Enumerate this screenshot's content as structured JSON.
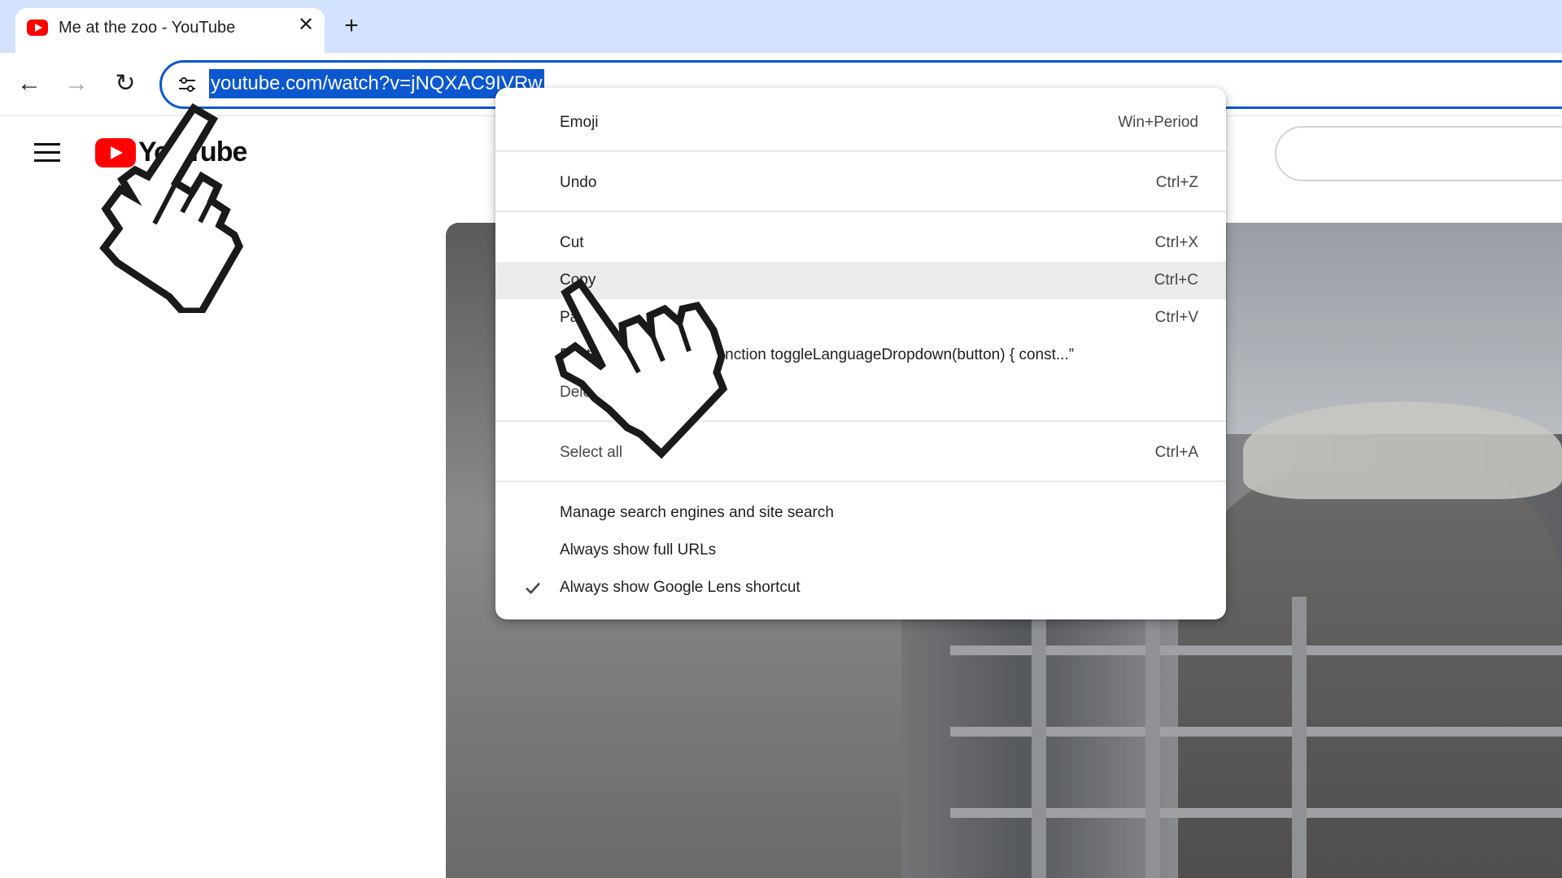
{
  "tab": {
    "title": "Me at the zoo - YouTube",
    "close_glyph": "✕",
    "favicon": "youtube-favicon"
  },
  "newtab_glyph": "+",
  "toolbar": {
    "back_glyph": "←",
    "forward_glyph": "→",
    "reload_glyph": "↻"
  },
  "omnibox": {
    "url": "youtube.com/watch?v=jNQXAC9IVRw",
    "selection_color": "#0b57d0",
    "icon": "site-info-tune-icon"
  },
  "youtube": {
    "logo_text": "YouTube",
    "brand_color": "#ff0000"
  },
  "context_menu": {
    "emoji": {
      "label": "Emoji",
      "shortcut": "Win+Period"
    },
    "undo": {
      "label": "Undo",
      "shortcut": "Ctrl+Z"
    },
    "cut": {
      "label": "Cut",
      "shortcut": "Ctrl+X"
    },
    "copy": {
      "label": "Copy",
      "shortcut": "Ctrl+C"
    },
    "paste": {
      "label": "Paste",
      "shortcut": "Ctrl+V"
    },
    "paste_and_go": {
      "label": "Paste and go to",
      "preview": "“function toggleLanguageDropdown(button) { const...”"
    },
    "delete": {
      "label": "Delete"
    },
    "select_all": {
      "label": "Select all",
      "shortcut": "Ctrl+A"
    },
    "manage_search": {
      "label": "Manage search engines and site search"
    },
    "full_urls": {
      "label": "Always show full URLs"
    },
    "lens": {
      "label": "Always show Google Lens shortcut",
      "checked": true
    }
  }
}
